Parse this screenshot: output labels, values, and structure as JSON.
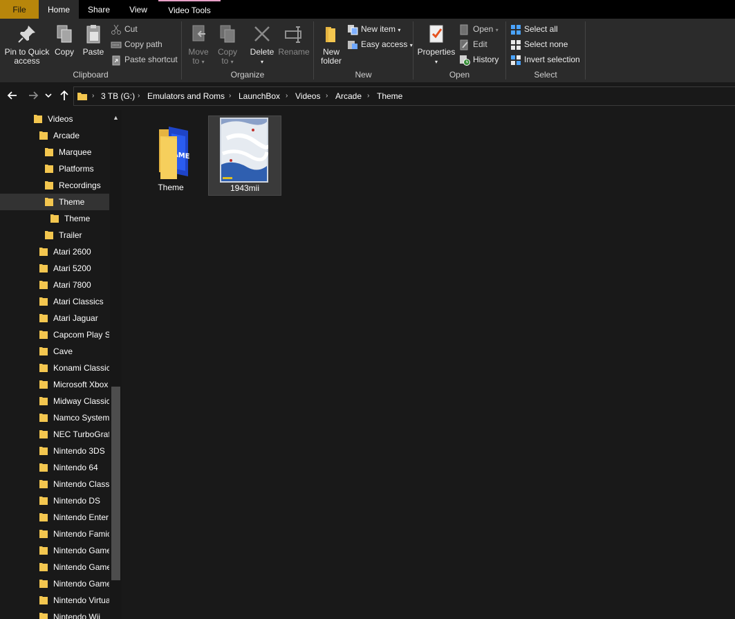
{
  "tabs": {
    "file": "File",
    "home": "Home",
    "share": "Share",
    "view": "View",
    "video_tools": "Video Tools"
  },
  "ribbon": {
    "clipboard": {
      "label": "Clipboard",
      "pin_line1": "Pin to Quick",
      "pin_line2": "access",
      "copy": "Copy",
      "paste": "Paste",
      "cut": "Cut",
      "copy_path": "Copy path",
      "paste_shortcut": "Paste shortcut"
    },
    "organize": {
      "label": "Organize",
      "move_line1": "Move",
      "move_line2": "to",
      "copy_line1": "Copy",
      "copy_line2": "to",
      "delete": "Delete",
      "rename": "Rename"
    },
    "new": {
      "label": "New",
      "folder_line1": "New",
      "folder_line2": "folder",
      "new_item": "New item",
      "easy_access": "Easy access"
    },
    "open": {
      "label": "Open",
      "properties": "Properties",
      "open": "Open",
      "edit": "Edit",
      "history": "History"
    },
    "select": {
      "label": "Select",
      "select_all": "Select all",
      "select_none": "Select none",
      "invert": "Invert selection"
    }
  },
  "address": {
    "crumbs": [
      "3 TB (G:)",
      "Emulators and Roms",
      "LaunchBox",
      "Videos",
      "Arcade",
      "Theme"
    ]
  },
  "tree": [
    {
      "label": "Videos",
      "selected": false
    },
    {
      "label": "Arcade",
      "selected": false
    },
    {
      "label": "Marquee",
      "selected": false
    },
    {
      "label": "Platforms",
      "selected": false
    },
    {
      "label": "Recordings",
      "selected": false
    },
    {
      "label": "Theme",
      "selected": true
    },
    {
      "label": "Theme",
      "selected": false
    },
    {
      "label": "Trailer",
      "selected": false
    },
    {
      "label": "Atari 2600",
      "selected": false
    },
    {
      "label": "Atari 5200",
      "selected": false
    },
    {
      "label": "Atari 7800",
      "selected": false
    },
    {
      "label": "Atari Classics",
      "selected": false
    },
    {
      "label": "Atari Jaguar",
      "selected": false
    },
    {
      "label": "Capcom Play Sy",
      "selected": false
    },
    {
      "label": "Cave",
      "selected": false
    },
    {
      "label": "Konami Classics",
      "selected": false
    },
    {
      "label": "Microsoft Xbox",
      "selected": false
    },
    {
      "label": "Midway Classic",
      "selected": false
    },
    {
      "label": "Namco System",
      "selected": false
    },
    {
      "label": "NEC TurboGrafx",
      "selected": false
    },
    {
      "label": "Nintendo 3DS",
      "selected": false
    },
    {
      "label": "Nintendo 64",
      "selected": false
    },
    {
      "label": "Nintendo Classi",
      "selected": false
    },
    {
      "label": "Nintendo DS",
      "selected": false
    },
    {
      "label": "Nintendo Enter",
      "selected": false
    },
    {
      "label": "Nintendo Famic",
      "selected": false
    },
    {
      "label": "Nintendo Game",
      "selected": false
    },
    {
      "label": "Nintendo Game",
      "selected": false
    },
    {
      "label": "Nintendo Game",
      "selected": false
    },
    {
      "label": "Nintendo Virtua",
      "selected": false
    },
    {
      "label": "Nintendo Wii",
      "selected": false
    }
  ],
  "files": [
    {
      "name": "Theme",
      "type": "folder",
      "selected": false
    },
    {
      "name": "1943mii",
      "type": "video",
      "selected": true
    }
  ],
  "colors": {
    "file_tab": "#b8860b",
    "folder": "#f3c64f",
    "video_tools_accent": "#e8a1c8"
  }
}
